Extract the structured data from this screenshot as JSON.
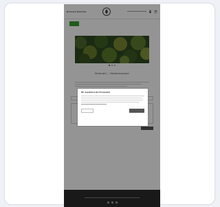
{
  "header": {
    "brand_text": "Brünnerl Reinthal",
    "logo_alt": "leaf-logo"
  },
  "nav": {
    "items": [
      "",
      "",
      "",
      "",
      "",
      ""
    ]
  },
  "hero": {
    "image_icon": "forest-photo"
  },
  "page": {
    "title": "Brünnerl – Hubertusraum"
  },
  "consent": {
    "title": "Wir respektieren Ihre Privatsphäre",
    "reject_label": "",
    "accept_label": ""
  },
  "footer": {
    "social_icons": [
      "facebook-icon",
      "instagram-icon",
      "mail-icon"
    ]
  },
  "colors": {
    "nav_active": "#33a02c",
    "footer_bg": "#2b2b2b",
    "overlay": "rgba(0,0,0,0.42)"
  }
}
